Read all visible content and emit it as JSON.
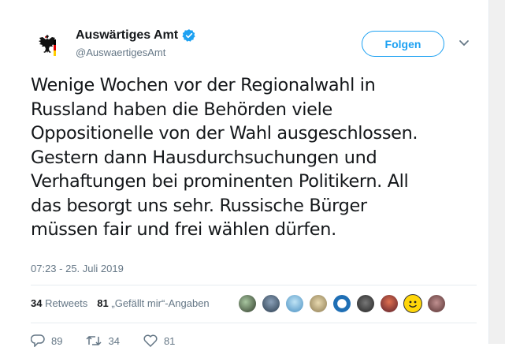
{
  "tweet": {
    "author_name": "Auswärtiges Amt",
    "author_handle": "@AuswaertigesAmt",
    "follow_label": "Folgen",
    "text": "Wenige Wochen vor der Regionalwahl in\nRussland haben die Behörden viele\nOppositionelle von der Wahl ausgeschlossen.\nGestern dann Hausdurchsuchungen und\nVerhaftungen bei prominenten Politikern. All\ndas besorgt uns sehr. Russische Bürger\nmüssen fair und frei wählen dürfen.",
    "timestamp": "07:23 - 25. Juli 2019",
    "retweets_count": "34",
    "retweets_label": "Retweets",
    "likes_count": "81",
    "likes_label": "„Gefällt mir“-Angaben",
    "actions": {
      "reply_count": "89",
      "retweet_count": "34",
      "like_count": "81"
    }
  },
  "colors": {
    "accent": "#1da1f2",
    "text": "#14171a",
    "secondary": "#657786"
  },
  "icons": {
    "avatar": "federal-eagle-icon",
    "verified": "verified-badge-icon",
    "menu": "chevron-down-icon"
  }
}
